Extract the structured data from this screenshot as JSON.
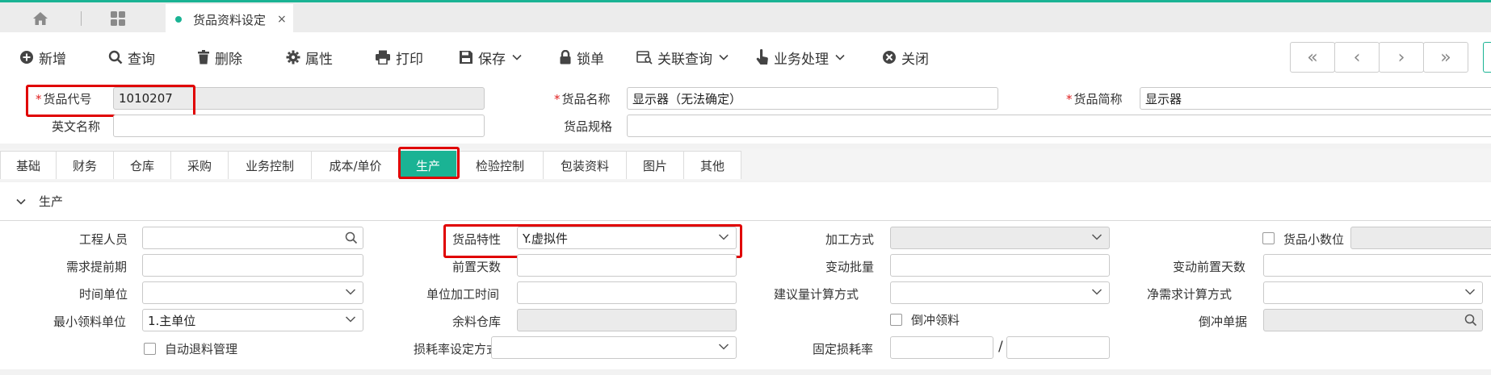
{
  "tabbar": {
    "doc_tab_title": "货品资料设定",
    "close_glyph": "×"
  },
  "toolbar": {
    "add": "新增",
    "query": "查询",
    "delete": "删除",
    "attributes": "属性",
    "print": "打印",
    "save": "保存",
    "lock": "锁单",
    "related_query": "关联查询",
    "business": "业务处理",
    "close": "关闭",
    "nav": [
      "«",
      "‹",
      "›",
      "»"
    ]
  },
  "header": {
    "code_label": "货品代号",
    "code_value": "1010207",
    "name_label": "货品名称",
    "name_value": "显示器（无法确定）",
    "short_label": "货品简称",
    "short_value": "显示器",
    "english_label": "英文名称",
    "english_value": "",
    "spec_label": "货品规格",
    "spec_value": ""
  },
  "tabs": [
    "基础",
    "财务",
    "仓库",
    "采购",
    "业务控制",
    "成本/单价",
    "生产",
    "检验控制",
    "包装资料",
    "图片",
    "其他"
  ],
  "active_tab": "生产",
  "section": {
    "title": "生产",
    "engineer_label": "工程人员",
    "engineer_value": "",
    "feature_label": "货品特性",
    "feature_value": "Y.虚拟件",
    "process_label": "加工方式",
    "process_value": "",
    "decimal_label": "货品小数位",
    "decimal_value": "",
    "lead_label": "需求提前期",
    "lead_value": "",
    "pre_days_label": "前置天数",
    "pre_days_value": "",
    "batch_label": "变动批量",
    "batch_value": "",
    "var_pre_days_label": "变动前置天数",
    "var_pre_days_value": "",
    "time_unit_label": "时间单位",
    "time_unit_value": "",
    "unit_time_label": "单位加工时间",
    "unit_time_value": "",
    "suggest_calc_label": "建议量计算方式",
    "suggest_calc_value": "",
    "net_calc_label": "净需求计算方式",
    "net_calc_value": "",
    "min_unit_label": "最小领料单位",
    "min_unit_value": "1.主单位",
    "scrap_wh_label": "余料仓库",
    "scrap_wh_value": "",
    "backflush_label": "倒冲领料",
    "backflush_doc_label": "倒冲单据",
    "backflush_doc_value": "",
    "auto_return_label": "自动退料管理",
    "loss_mode_label": "损耗率设定方式",
    "loss_mode_value": "",
    "fixed_loss_label": "固定损耗率",
    "fixed_loss_a": "",
    "fixed_loss_b": "",
    "slash": "/"
  },
  "colors": {
    "accent": "#1ab394",
    "required": "#e02020",
    "highlight": "#e00000"
  }
}
